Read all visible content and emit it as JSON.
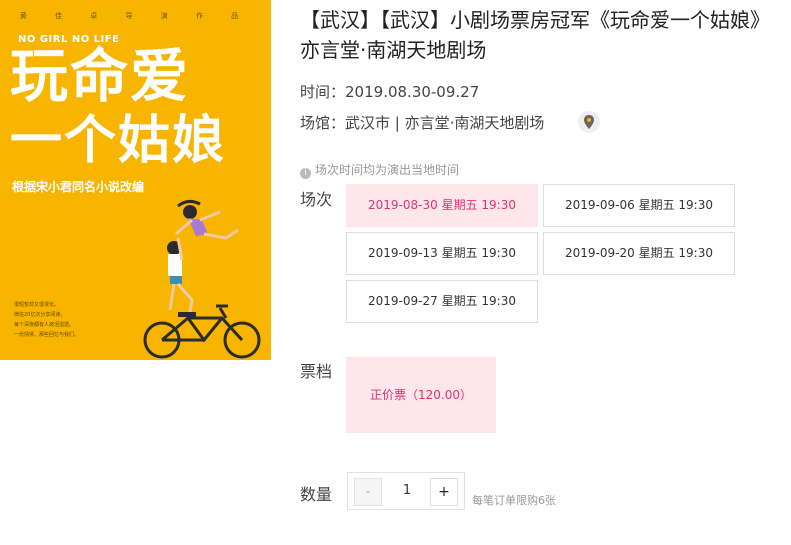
{
  "poster": {
    "credits": "黄 佳 卓 导 演 作 品",
    "slogan": "NO GIRL NO LIFE",
    "line1": "玩命爱",
    "line2": "一个姑娘",
    "subtitle": "根据宋小君同名小说改编",
    "small_lines": [
      "很短暂却又很漫长。",
      "微信20亿次分享阅读。",
      "每个深夜都有人被泪湿透。",
      "一份情愫、那些回忆与我们。"
    ]
  },
  "event": {
    "title": "【武汉】【武汉】小剧场票房冠军《玩命爱一个姑娘》亦言堂·南湖天地剧场",
    "time_label": "时间：",
    "time_value": "2019.08.30-09.27",
    "venue_label": "场馆：",
    "venue_value": "武汉市 | 亦言堂·南湖天地剧场",
    "note": "场次时间均为演出当地时间"
  },
  "sessions": {
    "label": "场次",
    "items": [
      {
        "text": "2019-08-30 星期五 19:30",
        "selected": true
      },
      {
        "text": "2019-09-06 星期五 19:30",
        "selected": false
      },
      {
        "text": "2019-09-13 星期五 19:30",
        "selected": false
      },
      {
        "text": "2019-09-20 星期五 19:30",
        "selected": false
      },
      {
        "text": "2019-09-27 星期五 19:30",
        "selected": false
      }
    ]
  },
  "tickets": {
    "label": "票档",
    "items": [
      {
        "text": "正价票（120.00）",
        "selected": true
      }
    ]
  },
  "quantity": {
    "label": "数量",
    "minus": "-",
    "plus": "+",
    "value": "1",
    "limit_note": "每笔订单限购6张"
  },
  "colors": {
    "accent": "#e0336e",
    "accent_bg": "#fde6ec",
    "poster_bg": "#f7b500"
  }
}
